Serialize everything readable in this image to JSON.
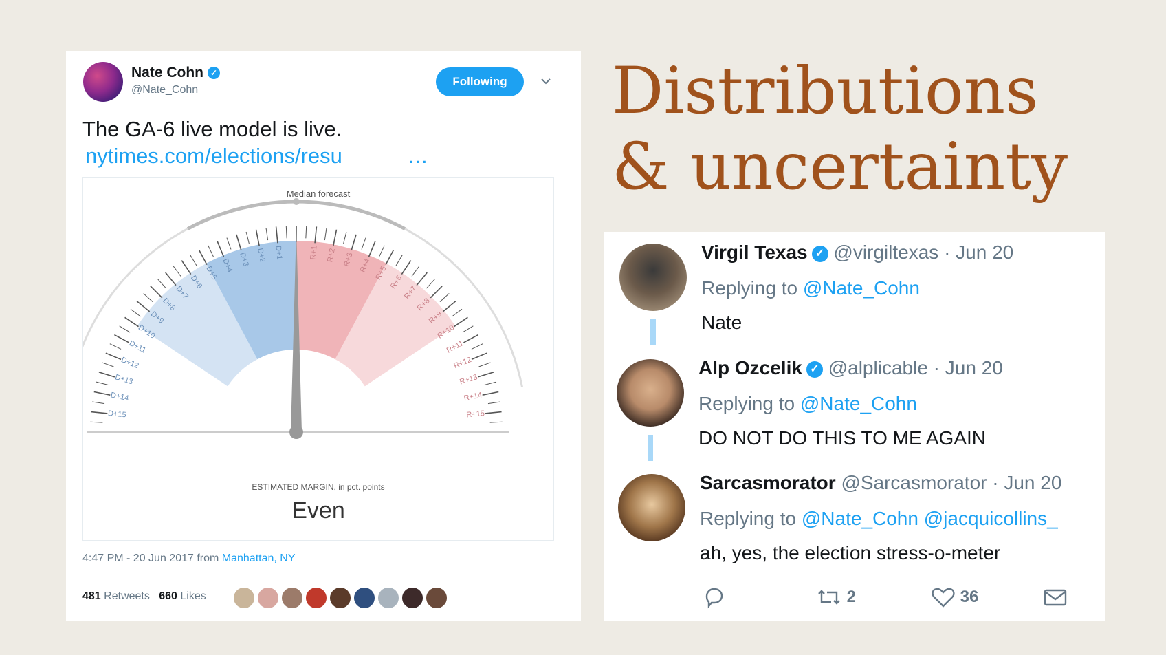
{
  "slide": {
    "title_line1": "Distributions",
    "title_line2": "& uncertainty"
  },
  "main_tweet": {
    "author_name": "Nate Cohn",
    "author_handle": "@Nate_Cohn",
    "follow_label": "Following",
    "text": "The GA-6 live model is live.",
    "link": "nytimes.com/elections/resu",
    "link_ellipsis": "…",
    "timestamp": "4:47 PM - 20 Jun 2017 from",
    "location": "Manhattan, NY",
    "retweets_count": "481",
    "retweets_label": "Retweets",
    "likes_count": "660",
    "likes_label": "Likes",
    "gauge": {
      "median_label": "Median forecast",
      "margin_label": "ESTIMATED MARGIN,",
      "margin_unit": "in pct. points",
      "margin_value": "Even",
      "dem_ticks": [
        "D+1",
        "D+2",
        "D+3",
        "D+4",
        "D+5",
        "D+6",
        "D+7",
        "D+8",
        "D+9",
        "D+10",
        "D+11",
        "D+12",
        "D+13",
        "D+14",
        "D+15"
      ],
      "rep_ticks": [
        "R+1",
        "R+2",
        "R+3",
        "R+4",
        "R+5",
        "R+6",
        "R+7",
        "R+8",
        "R+9",
        "R+10",
        "R+11",
        "R+12",
        "R+13",
        "R+14",
        "R+15"
      ],
      "needle_value": 0,
      "colors": {
        "dem_dark": "#a8c8e8",
        "dem_light": "#d4e3f3",
        "rep_dark": "#f0b4b8",
        "rep_light": "#f7d9db"
      }
    }
  },
  "replies": [
    {
      "name": "Virgil Texas",
      "handle": "@virgiltexas · Jun 20",
      "replying_prefix": "Replying to",
      "mentions": "@Nate_Cohn",
      "text": "Nate"
    },
    {
      "name": "Alp Ozcelik",
      "handle": "@alplicable · Jun 20",
      "replying_prefix": "Replying to",
      "mentions": "@Nate_Cohn",
      "text": "DO NOT DO THIS TO ME AGAIN"
    },
    {
      "name": "Sarcasmorator",
      "handle": "@Sarcasmorator · Jun 20",
      "replying_prefix": "Replying to",
      "mentions": "@Nate_Cohn @jacquicollins_",
      "text": "ah, yes, the election stress-o-meter"
    }
  ],
  "reply_actions": {
    "retweet_count": "2",
    "like_count": "36"
  },
  "colors": {
    "title": "#a0521c",
    "twitter_blue": "#1da1f2",
    "background": "#eeebe4"
  }
}
